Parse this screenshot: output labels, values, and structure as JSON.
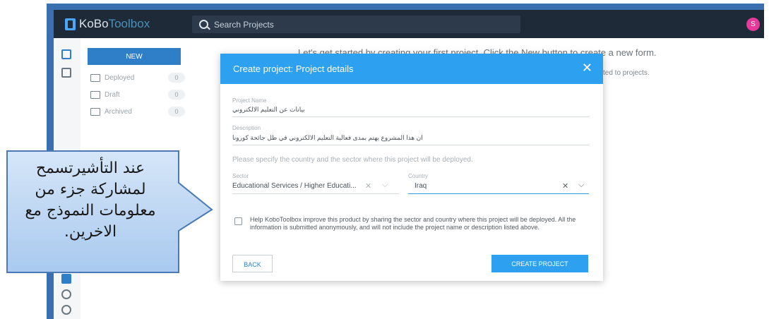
{
  "topbar": {
    "logo_part1": "KoBo",
    "logo_part2": "Toolbox",
    "search_placeholder": "Search Projects",
    "avatar_initial": "S"
  },
  "sidebar": {
    "new_label": "NEW",
    "items": [
      {
        "label": "Deployed",
        "count": "0",
        "icon": "deployed-icon"
      },
      {
        "label": "Draft",
        "count": "0",
        "icon": "draft-icon"
      },
      {
        "label": "Archived",
        "count": "0",
        "icon": "archived-icon"
      }
    ]
  },
  "main": {
    "message": "Let's get started by creating your first project. Click the New button to create a new form.",
    "sub_message": "ted to projects."
  },
  "modal": {
    "title": "Create project: Project details",
    "close_symbol": "✕",
    "project_name_label": "Project Name",
    "project_name_value": "بيانات عن التعليم الالكتروني",
    "description_label": "Description",
    "description_value": "ان هذا المشروع يهتم بمدى فعالية التعليم الالكتروني في ظل جائحة كورونا",
    "hint": "Please specify the country and the sector where this project will be deployed.",
    "sector_label": "Sector",
    "sector_value": "Educational Services / Higher Educati...",
    "country_label": "Country",
    "country_value": "Iraq",
    "consent_text": "Help KoboToolbox improve this product by sharing the sector and country where this project will be deployed. All the information is submitted anonymously, and will not include the project name or description listed above.",
    "back_label": "BACK",
    "create_label": "CREATE PROJECT"
  },
  "callout": {
    "lines": [
      "عند التأشيرتسمح",
      "لمشاركة جزء من",
      "معلومات النموذج مع",
      "الاخرين."
    ]
  },
  "colors": {
    "accent": "#2ea0f0",
    "topbar": "#1e2a38",
    "callout_fill": "#b9d4f2",
    "avatar": "#e6399b"
  }
}
